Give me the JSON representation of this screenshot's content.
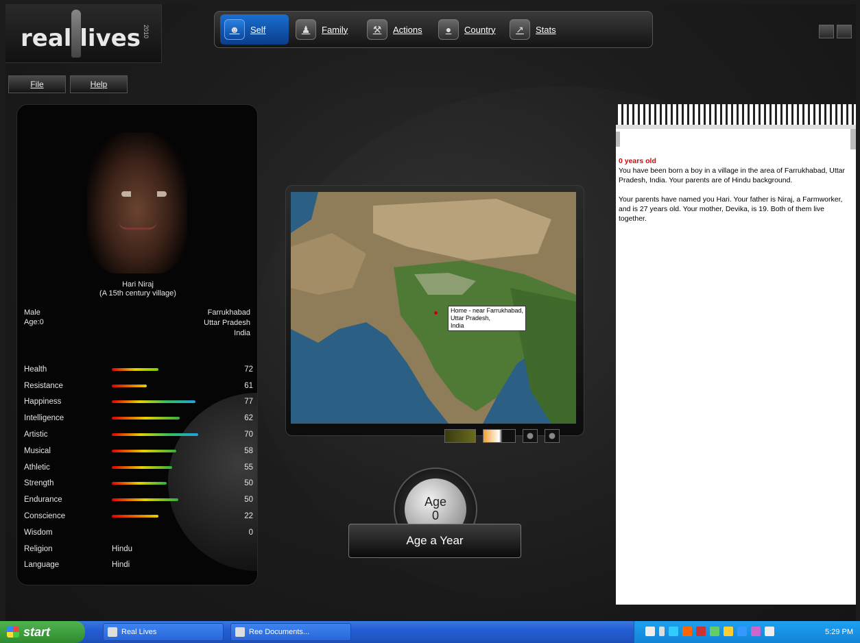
{
  "app": {
    "logo_text": "real lives",
    "logo_year": "2010"
  },
  "nav": [
    {
      "label": "Self",
      "icon": "person-icon",
      "active": true
    },
    {
      "label": "Family",
      "icon": "family-icon",
      "active": false
    },
    {
      "label": "Actions",
      "icon": "actions-icon",
      "active": false
    },
    {
      "label": "Country",
      "icon": "globe-icon",
      "active": false
    },
    {
      "label": "Stats",
      "icon": "chart-icon",
      "active": false
    }
  ],
  "menu": {
    "file": "File",
    "help": "Help"
  },
  "character": {
    "name": "Hari Niraj",
    "subtitle": "(A 15th century village)",
    "sex": "Male",
    "age": "Age:0",
    "location": [
      "Farrukhabad",
      "Uttar Pradesh",
      "India"
    ],
    "stats": [
      {
        "name": "Health",
        "value": "72",
        "fill": 0.4,
        "color": "linear-gradient(90deg,#e00000,#e6d200,#7bd000)"
      },
      {
        "name": "Resistance",
        "value": "61",
        "fill": 0.3,
        "color": "linear-gradient(90deg,#e00000,#e6d200)"
      },
      {
        "name": "Happiness",
        "value": "77",
        "fill": 0.72,
        "color": "linear-gradient(90deg,#e00000,#e6d200,#30c060,#20a0e0)"
      },
      {
        "name": "Intelligence",
        "value": "62",
        "fill": 0.58,
        "color": "linear-gradient(90deg,#e00000,#e6d200,#30b040)"
      },
      {
        "name": "Artistic",
        "value": "70",
        "fill": 0.74,
        "color": "linear-gradient(90deg,#e00000,#e6d200,#30c060,#20a0e0)"
      },
      {
        "name": "Musical",
        "value": "58",
        "fill": 0.55,
        "color": "linear-gradient(90deg,#e00000,#e6d200,#30b040)"
      },
      {
        "name": "Athletic",
        "value": "55",
        "fill": 0.52,
        "color": "linear-gradient(90deg,#e00000,#e6d200,#30b040)"
      },
      {
        "name": "Strength",
        "value": "50",
        "fill": 0.47,
        "color": "linear-gradient(90deg,#e00000,#e6d200,#30b040)"
      },
      {
        "name": "Endurance",
        "value": "50",
        "fill": 0.57,
        "color": "linear-gradient(90deg,#e00000,#e6d200,#30b040)"
      },
      {
        "name": "Conscience",
        "value": "22",
        "fill": 0.4,
        "color": "linear-gradient(90deg,#e00000,#e6d200)"
      },
      {
        "name": "Wisdom",
        "value": "0",
        "fill": 0,
        "color": "transparent"
      }
    ],
    "religion_label": "Religion",
    "religion": "Hindu",
    "language_label": "Language",
    "language": "Hindi"
  },
  "map": {
    "home_label": [
      "Home - near Farrukhabad,",
      "Uttar Pradesh,",
      "India"
    ]
  },
  "age_dial": {
    "label": "Age",
    "value": "0"
  },
  "age_button": "Age a Year",
  "journal": {
    "heading": "0 years old",
    "para1": "You have been born a boy in a village in the area of Farrukhabad, Uttar Pradesh, India. Your parents are of Hindu background.",
    "para2": "Your parents have named you Hari. Your father is Niraj, a Farmworker, and is 27 years old. Your mother, Devika, is 19. Both of them live together."
  },
  "taskbar": {
    "start": "start",
    "tasks": [
      "Real Lives",
      "Ree Documents..."
    ],
    "clock": "5:29 PM"
  },
  "colors": {
    "accent": "#1a6ed0",
    "journal_heading": "#e00000"
  }
}
